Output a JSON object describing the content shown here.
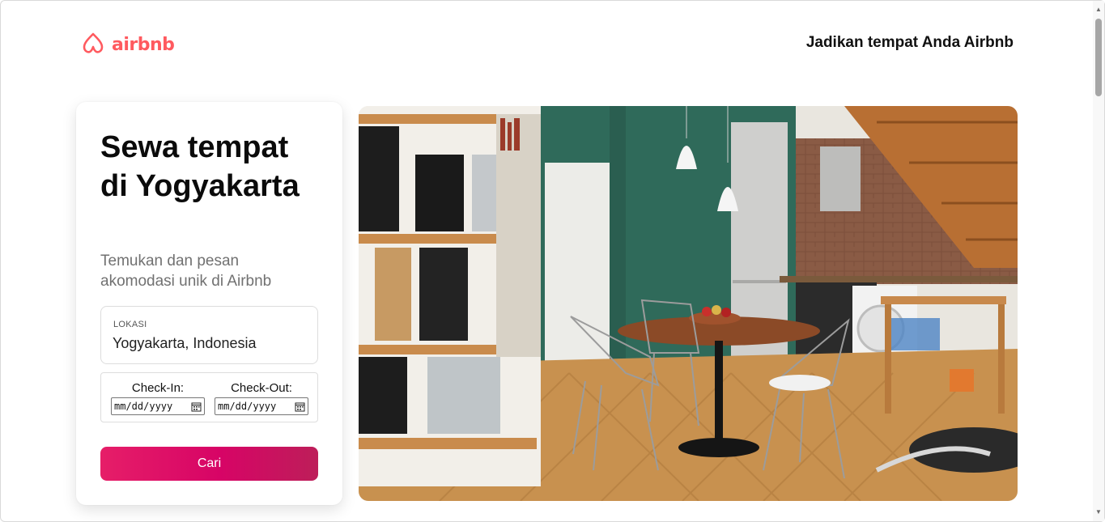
{
  "header": {
    "logo_text": "airbnb",
    "host_link": "Jadikan tempat Anda Airbnb"
  },
  "search_card": {
    "headline": "Sewa tempat di Yogyakarta",
    "subhead": "Temukan dan pesan akomodasi unik di Airbnb",
    "location": {
      "label": "LOKASI",
      "value": "Yogyakarta, Indonesia"
    },
    "check_in": {
      "label": "Check-In:",
      "placeholder": "mm/dd/yyyy"
    },
    "check_out": {
      "label": "Check-Out:",
      "placeholder": "mm/dd/yyyy"
    },
    "button_label": "Cari"
  },
  "icons": {
    "logo": "airbnb-logo-icon",
    "calendar": "calendar-icon",
    "scroll_up": "chevron-up-icon",
    "scroll_down": "chevron-down-icon"
  },
  "colors": {
    "brand": "#FF5A5F",
    "button_start": "#E61E68",
    "button_end": "#BD1E59",
    "subtext": "#717171"
  }
}
